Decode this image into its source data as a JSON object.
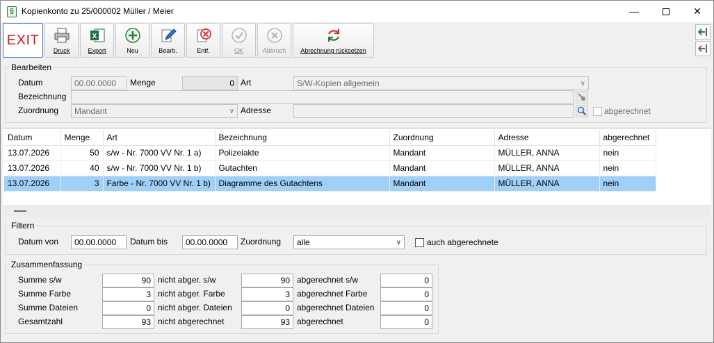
{
  "window": {
    "title": "Kopienkonto zu 25/000002 Müller / Meier",
    "app_icon": "§"
  },
  "toolbar": {
    "exit": "EXIT",
    "druck": "Druck",
    "export": "Export",
    "neu": "Neu",
    "bearb": "Bearb.",
    "entf": "Entf.",
    "ok": "OK",
    "abbruch": "Abbruch",
    "reset": "Abrechnung rücksetzen"
  },
  "bearbeiten": {
    "title": "Bearbeiten",
    "datum_label": "Datum",
    "datum_value": "00.00.0000",
    "menge_label": "Menge",
    "menge_value": "0",
    "art_label": "Art",
    "art_value": "S/W-Kopien allgemein",
    "bezeichnung_label": "Bezeichnung",
    "bezeichnung_value": "",
    "zuordnung_label": "Zuordnung",
    "zuordnung_value": "Mandant",
    "adresse_label": "Adresse",
    "adresse_value": "",
    "abgerechnet_label": "abgerechnet"
  },
  "table": {
    "columns": [
      "Datum",
      "Menge",
      "Art",
      "Bezeichnung",
      "Zuordnung",
      "Adresse",
      "abgerechnet"
    ],
    "rows": [
      [
        "13.07.2026",
        "50",
        "s/w - Nr. 7000 VV Nr. 1 a)",
        "Polizeiakte",
        "Mandant",
        "MÜLLER, ANNA",
        "nein"
      ],
      [
        "13.07.2026",
        "40",
        "s/w - Nr. 7000 VV Nr. 1 b)",
        "Gutachten",
        "Mandant",
        "MÜLLER, ANNA",
        "nein"
      ],
      [
        "13.07.2026",
        "3",
        "Farbe - Nr. 7000 VV Nr. 1 b)",
        "Diagramme des Gutachtens",
        "Mandant",
        "MÜLLER, ANNA",
        "nein"
      ]
    ],
    "selected_row": 2
  },
  "filtern": {
    "title": "Filtern",
    "datum_von_label": "Datum von",
    "datum_von_value": "00.00.0000",
    "datum_bis_label": "Datum bis",
    "datum_bis_value": "00.00.0000",
    "zuordnung_label": "Zuordnung",
    "zuordnung_value": "alle",
    "auch_label": "auch abgerechnete"
  },
  "zusammenfassung": {
    "title": "Zusammenfassung",
    "col1": [
      {
        "label": "Summe s/w",
        "value": "90"
      },
      {
        "label": "Summe Farbe",
        "value": "3"
      },
      {
        "label": "Summe Dateien",
        "value": "0"
      },
      {
        "label": "Gesamtzahl",
        "value": "93"
      }
    ],
    "col2": [
      {
        "label": "nicht abger. s/w",
        "value": "90"
      },
      {
        "label": "nicht abger. Farbe",
        "value": "3"
      },
      {
        "label": "nicht abger. Dateien",
        "value": "0"
      },
      {
        "label": "nicht abgerechnet",
        "value": "93"
      }
    ],
    "col3": [
      {
        "label": "abgerechnet s/w",
        "value": "0"
      },
      {
        "label": "abgerechnet Farbe",
        "value": "0"
      },
      {
        "label": "abgerechnet Dateien",
        "value": "0"
      },
      {
        "label": "abgerechnet",
        "value": "0"
      }
    ]
  }
}
